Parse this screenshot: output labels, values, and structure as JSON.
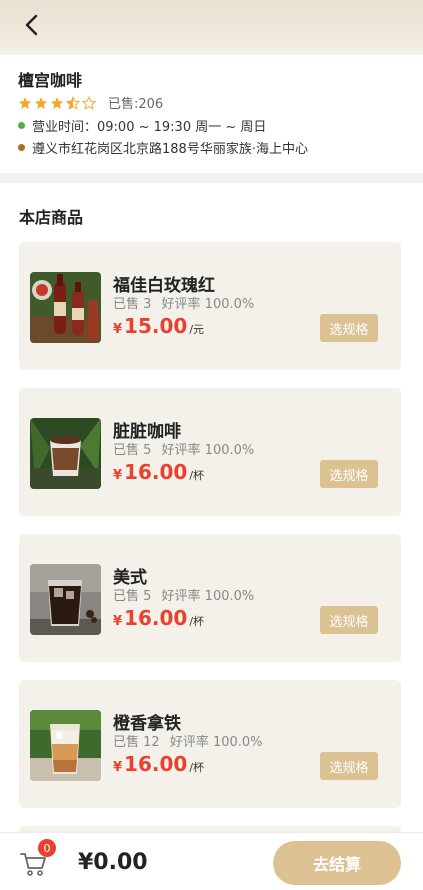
{
  "shop": {
    "name": "檀宫咖啡",
    "rating": 3.5,
    "max_rating": 5,
    "sold_label": "已售:206",
    "hours": "营业时间：09:00 ~ 19:30 周一 ~ 周日",
    "address": "遵义市红花岗区北京路188号华丽家族·海上中心",
    "hours_dot_color": "#4caf50",
    "address_dot_color": "#a8731e"
  },
  "section_title": "本店商品",
  "products": [
    {
      "name": "福佳白玫瑰红",
      "sold": "已售 3",
      "rate": "好评率 100.0%",
      "currency": "¥",
      "price": "15.00",
      "unit": "/元",
      "button": "选规格"
    },
    {
      "name": "脏脏咖啡",
      "sold": "已售 5",
      "rate": "好评率 100.0%",
      "currency": "¥",
      "price": "16.00",
      "unit": "/杯",
      "button": "选规格"
    },
    {
      "name": "美式",
      "sold": "已售 5",
      "rate": "好评率 100.0%",
      "currency": "¥",
      "price": "16.00",
      "unit": "/杯",
      "button": "选规格"
    },
    {
      "name": "橙香拿铁",
      "sold": "已售 12",
      "rate": "好评率 100.0%",
      "currency": "¥",
      "price": "16.00",
      "unit": "/杯",
      "button": "选规格"
    }
  ],
  "cart": {
    "badge": "0",
    "total": "¥0.00",
    "checkout_label": "去结算"
  },
  "colors": {
    "accent": "#dcc293",
    "price": "#e9412e",
    "star": "#f5a623"
  }
}
